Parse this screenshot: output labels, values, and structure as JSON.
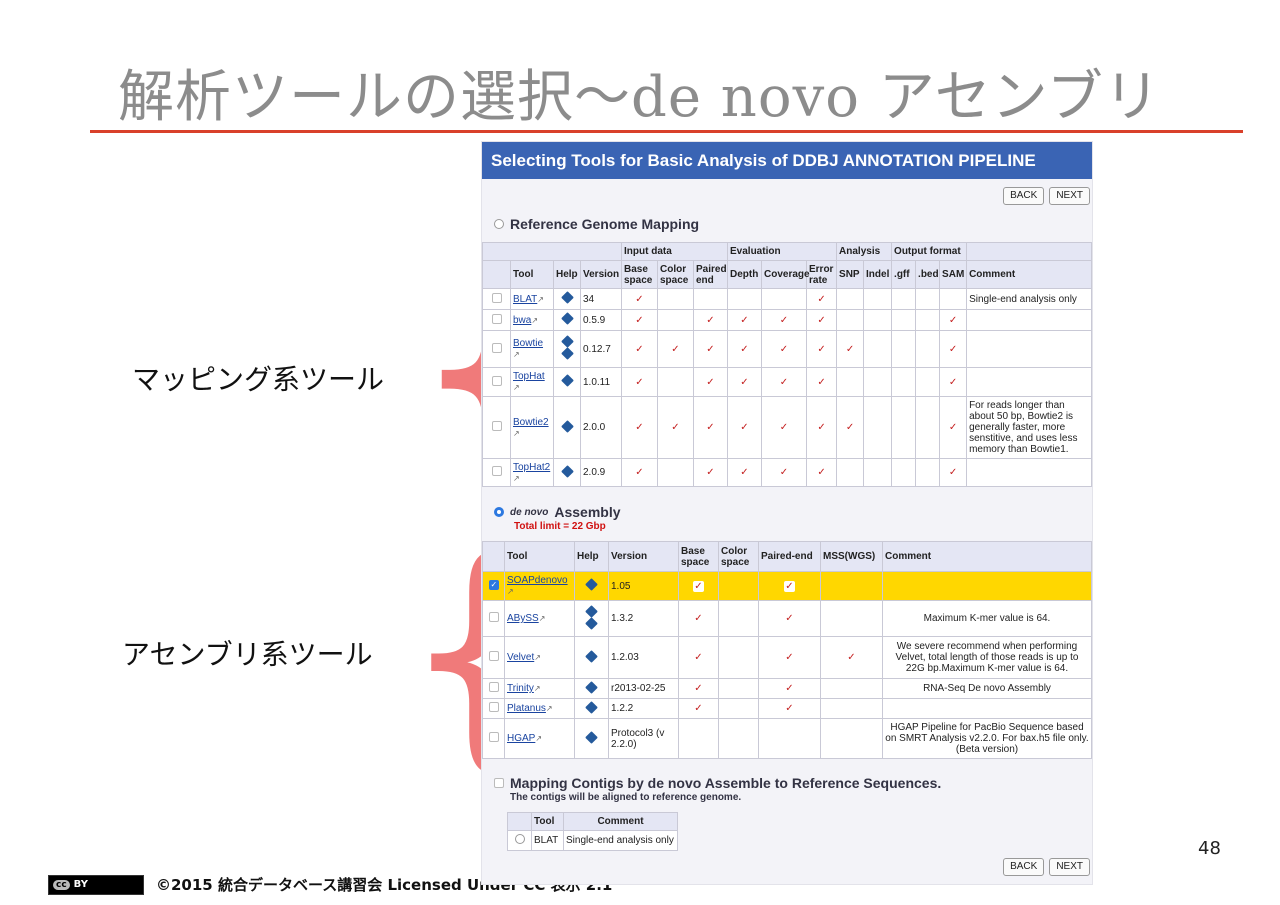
{
  "slide": {
    "title": "解析ツールの選択〜de novo アセンブリ",
    "page_number": "48",
    "footer_text": "©2015 統合データベース講習会 Licensed Under CC 表示 2.1",
    "badge_cc": "cc",
    "badge_by": "BY",
    "label_mapping": "マッピング系ツール",
    "label_assembly": "アセンブリ系ツール",
    "accent_color": "#d9402a",
    "brace_color": "#f07a7a",
    "brace_glyph": "{"
  },
  "panel": {
    "header": "Selecting Tools for Basic Analysis of DDBJ ANNOTATION PIPELINE",
    "back_label": "BACK",
    "next_label": "NEXT",
    "header_color": "#3a64b4"
  },
  "mapping": {
    "section_title": "Reference Genome Mapping",
    "group_headers": [
      "Input data",
      "Evaluation",
      "Analysis",
      "Output format"
    ],
    "col_headers": [
      "Tool",
      "Help",
      "Version",
      "Base space",
      "Color space",
      "Paired end",
      "Depth",
      "Coverage",
      "Error rate",
      "SNP",
      "Indel",
      ".gff",
      ".bed",
      "SAM",
      "Comment"
    ],
    "check_glyph": "✓",
    "rows": [
      {
        "tool": "BLAT",
        "version": "34",
        "comment": "Single-end analysis only"
      },
      {
        "tool": "bwa",
        "version": "0.5.9",
        "comment": ""
      },
      {
        "tool": "Bowtie",
        "version": "0.12.7",
        "comment": ""
      },
      {
        "tool": "TopHat",
        "version": "1.0.11",
        "comment": ""
      },
      {
        "tool": "Bowtie2",
        "version": "2.0.0",
        "comment": "For reads longer than about 50 bp, Bowtie2 is generally faster, more senstitive, and uses less memory than Bowtie1."
      },
      {
        "tool": "TopHat2",
        "version": "2.0.9",
        "comment": ""
      }
    ]
  },
  "assembly": {
    "section_title_italic": "de novo",
    "section_title_rest": "Assembly",
    "limit_note": "Total limit = 22 Gbp",
    "col_headers": [
      "Tool",
      "Help",
      "Version",
      "Base space",
      "Color space",
      "Paired-end",
      "MSS(WGS)",
      "Comment"
    ],
    "rows": [
      {
        "tool": "SOAPdenovo",
        "version": "1.05",
        "comment": "",
        "selected": true
      },
      {
        "tool": "ABySS",
        "version": "1.3.2",
        "comment": "Maximum K-mer value is 64."
      },
      {
        "tool": "Velvet",
        "version": "1.2.03",
        "comment": "We severe recommend when performing Velvet, total length of those reads is up to 22G bp.Maximum K-mer value is 64."
      },
      {
        "tool": "Trinity",
        "version": "r2013-02-25",
        "comment": "RNA-Seq De novo Assembly"
      },
      {
        "tool": "Platanus",
        "version": "1.2.2",
        "comment": ""
      },
      {
        "tool": "HGAP",
        "version": "Protocol3 (v 2.2.0)",
        "comment": "HGAP Pipeline for PacBio Sequence based on SMRT Analysis v2.2.0. For bax.h5 file only. (Beta version)"
      }
    ]
  },
  "contigs": {
    "section_title": "Mapping Contigs by de novo Assemble to Reference Sequences.",
    "note": "The contigs will be aligned to reference genome.",
    "col_tool": "Tool",
    "col_comment": "Comment",
    "row_tool": "BLAT",
    "row_comment": "Single-end analysis only"
  }
}
